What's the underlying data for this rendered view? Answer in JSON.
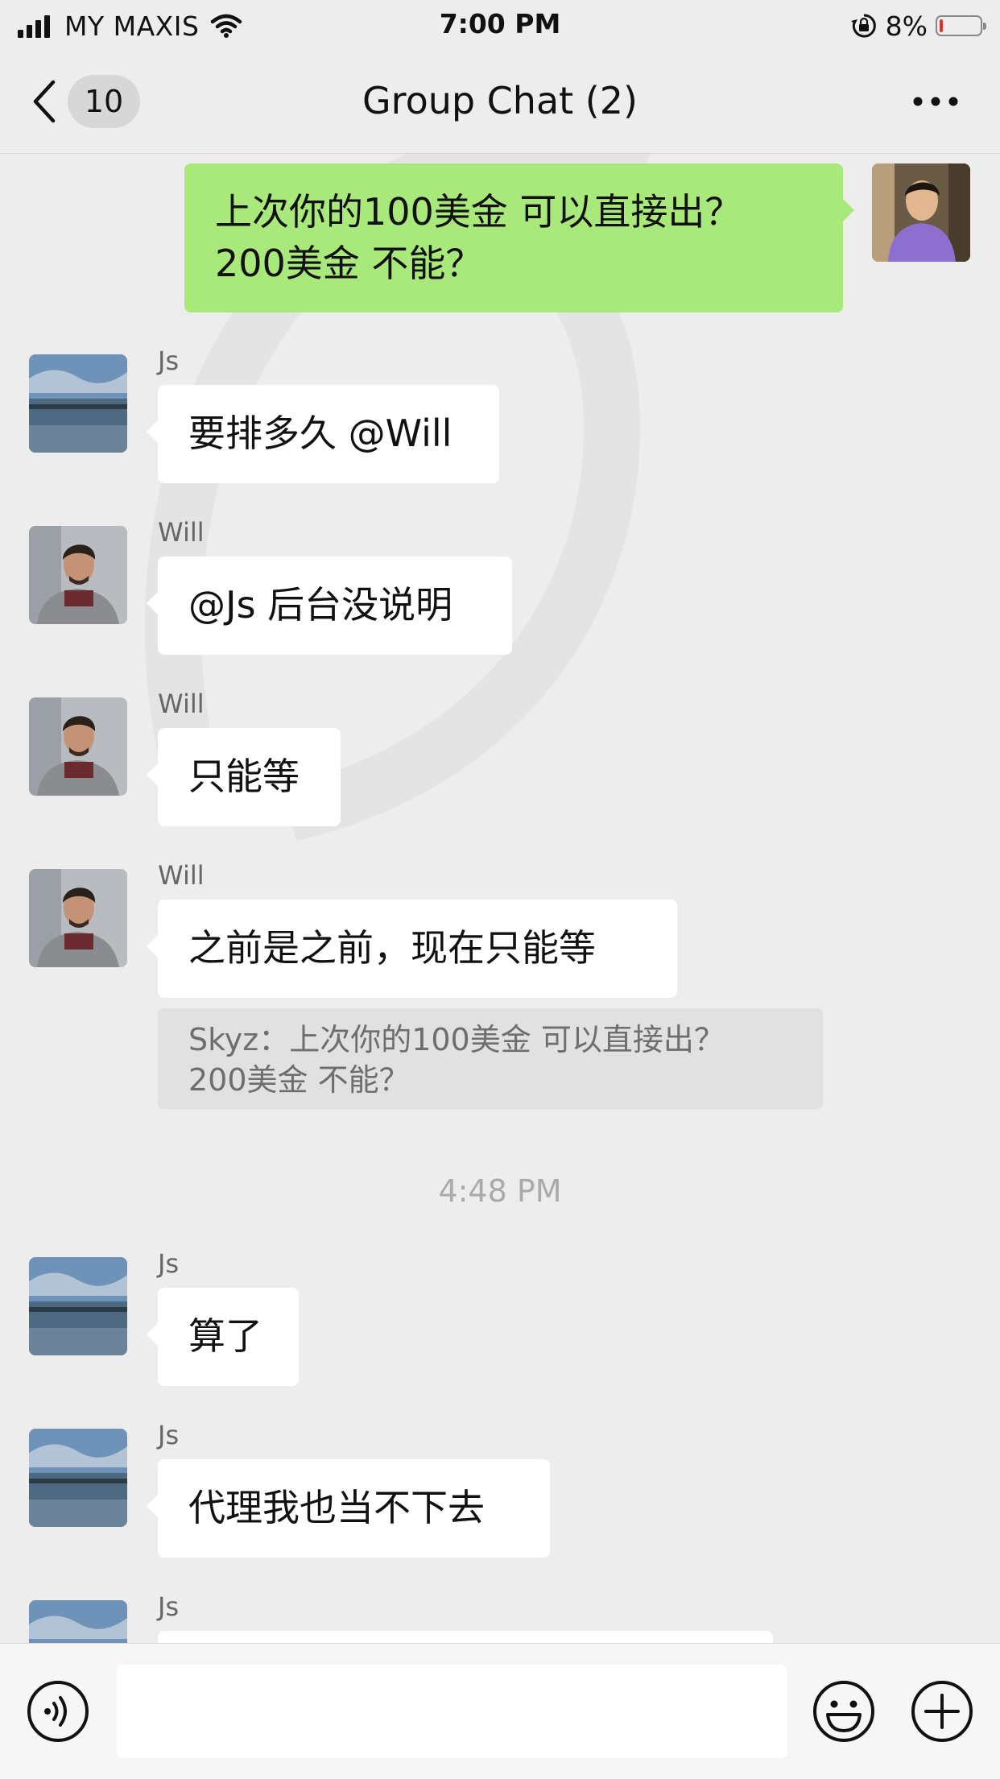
{
  "status_bar": {
    "carrier": "MY MAXIS",
    "time": "7:00 PM",
    "battery_percent": "8%",
    "battery_level": 0.08
  },
  "nav": {
    "back_count": "10",
    "title": "Group Chat (2)"
  },
  "messages": [
    {
      "sender": "",
      "text": "上次你的100美金 可以直接出？\n200美金 不能？",
      "outgoing": true
    },
    {
      "sender": "Js",
      "text": "要排多久 @Will"
    },
    {
      "sender": "Will",
      "text": "@Js 后台没说明"
    },
    {
      "sender": "Will",
      "text": "只能等"
    },
    {
      "sender": "Will",
      "text": "之前是之前，现在只能等",
      "quote": "Skyz：上次你的100美金 可以直接出？\n200美金 不能？"
    },
    {
      "sender": "Js",
      "text": "算了"
    },
    {
      "sender": "Js",
      "text": "代理我也当不下去"
    },
    {
      "sender": "Js",
      "text": ""
    }
  ],
  "timestamp": "4:48 PM",
  "input": {
    "placeholder": ""
  },
  "icons": {
    "back": "chevron-left-icon",
    "more": "more-dots-icon",
    "voice": "voice-icon",
    "emoji": "emoji-icon",
    "plus": "plus-icon"
  },
  "colors": {
    "background": "#ededed",
    "outgoing_bubble": "#a9e87a",
    "incoming_bubble": "#ffffff",
    "battery_low": "#e0302a"
  }
}
